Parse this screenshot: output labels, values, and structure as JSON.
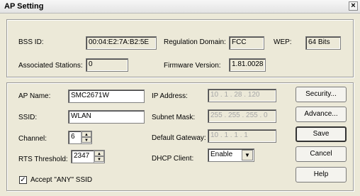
{
  "window": {
    "title": "AP Setting",
    "close_glyph": "×"
  },
  "status": {
    "bss_id_label": "BSS ID:",
    "bss_id_value": "00:04:E2:7A:B2:5E",
    "regulation_domain_label": "Regulation Domain:",
    "regulation_domain_value": "FCC",
    "wep_label": "WEP:",
    "wep_value": "64 Bits",
    "associated_stations_label": "Associated Stations:",
    "associated_stations_value": "0",
    "firmware_version_label": "Firmware Version:",
    "firmware_version_value": "1.81.0028"
  },
  "config": {
    "ap_name_label": "AP Name:",
    "ap_name_value": "SMC2671W",
    "ssid_label": "SSID:",
    "ssid_value": "WLAN",
    "channel_label": "Channel:",
    "channel_value": "6",
    "rts_label": "RTS Threshold:",
    "rts_value": "2347",
    "ip_label": "IP Address:",
    "ip_value": "10  .  1  .  28  . 120",
    "subnet_label": "Subnet Mask:",
    "subnet_value": "255 . 255 . 255 .  0",
    "gateway_label": "Default Gateway:",
    "gateway_value": "10  .  1  .  1  .  1",
    "dhcp_label": "DHCP Client:",
    "dhcp_value": "Enable",
    "accept_any_label": "Accept \"ANY\" SSID",
    "accept_any_checked": true
  },
  "buttons": {
    "security": "Security...",
    "advance": "Advance...",
    "save": "Save",
    "cancel": "Cancel",
    "help": "Help"
  },
  "icons": {
    "spin_up": "▲",
    "spin_down": "▼",
    "dropdown": "▼",
    "check": "✓"
  }
}
